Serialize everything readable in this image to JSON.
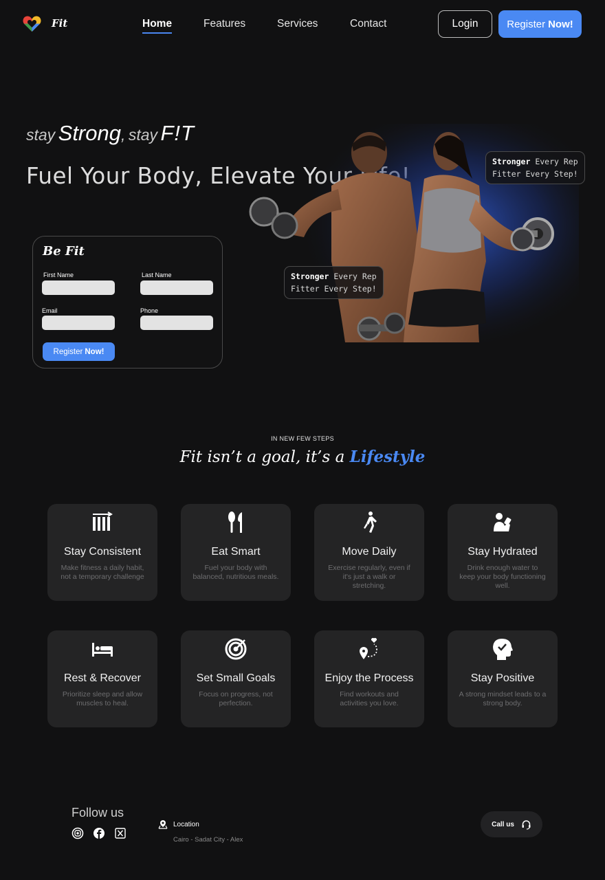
{
  "brand": {
    "name": "Fit"
  },
  "nav": {
    "links": [
      {
        "label": "Home",
        "active": true
      },
      {
        "label": "Features",
        "active": false
      },
      {
        "label": "Services",
        "active": false
      },
      {
        "label": "Contact",
        "active": false
      }
    ],
    "login_label": "Login",
    "register_label": "Register",
    "register_emphasis": "Now!"
  },
  "hero": {
    "tagline": {
      "stay1": "stay",
      "strong": "Strong",
      "comma": ",",
      "stay2": "stay",
      "fit": "F!T"
    },
    "headline": "Fuel Your Body, Elevate Your Life!",
    "bubble_top": {
      "bold": "Stronger",
      "rest": "Every Rep",
      "line2": "Fitter Every Step!"
    },
    "bubble_bottom": {
      "bold": "Stronger",
      "rest": "Every Rep",
      "line2": "Fitter Every Step!"
    }
  },
  "form": {
    "title": "Be Fit",
    "first_name_label": "First Name",
    "last_name_label": "Last Name",
    "email_label": "Email",
    "phone_label": "Phone",
    "submit_label": "Register",
    "submit_emphasis": "Now!"
  },
  "steps": {
    "eyebrow": "IN NEW FEW STEPS",
    "title_prefix": "Fit isn’t a goal, it’s a",
    "title_accent": "Lifestyle",
    "cards": [
      {
        "icon": "consistency-bars-icon",
        "title": "Stay Consistent",
        "desc": "Make fitness a daily habit, not a temporary challenge"
      },
      {
        "icon": "fork-spoon-icon",
        "title": "Eat Smart",
        "desc": "Fuel your body with balanced, nutritious meals."
      },
      {
        "icon": "walking-person-icon",
        "title": "Move Daily",
        "desc": "Exercise regularly, even if it's just a walk or stretching."
      },
      {
        "icon": "drinking-person-icon",
        "title": "Stay Hydrated",
        "desc": "Drink enough water to keep your body functioning well."
      },
      {
        "icon": "bed-icon",
        "title": "Rest & Recover",
        "desc": "Prioritize sleep and allow muscles to heal."
      },
      {
        "icon": "target-icon",
        "title": "Set Small Goals",
        "desc": "Focus on progress, not perfection."
      },
      {
        "icon": "route-heart-icon",
        "title": "Enjoy the Process",
        "desc": "Find workouts and activities you love."
      },
      {
        "icon": "positive-head-icon",
        "title": "Stay Positive",
        "desc": "A strong mindset leads to a strong body."
      }
    ]
  },
  "footer": {
    "follow_label": "Follow us",
    "social_icons": [
      "instagram-icon",
      "facebook-icon",
      "x-icon"
    ],
    "location_label": "Location",
    "location_value": "Cairo - Sadat City - Alex",
    "call_label": "Call us"
  },
  "colors": {
    "accent": "#4a89f3",
    "background": "#111112",
    "card": "#242425"
  }
}
